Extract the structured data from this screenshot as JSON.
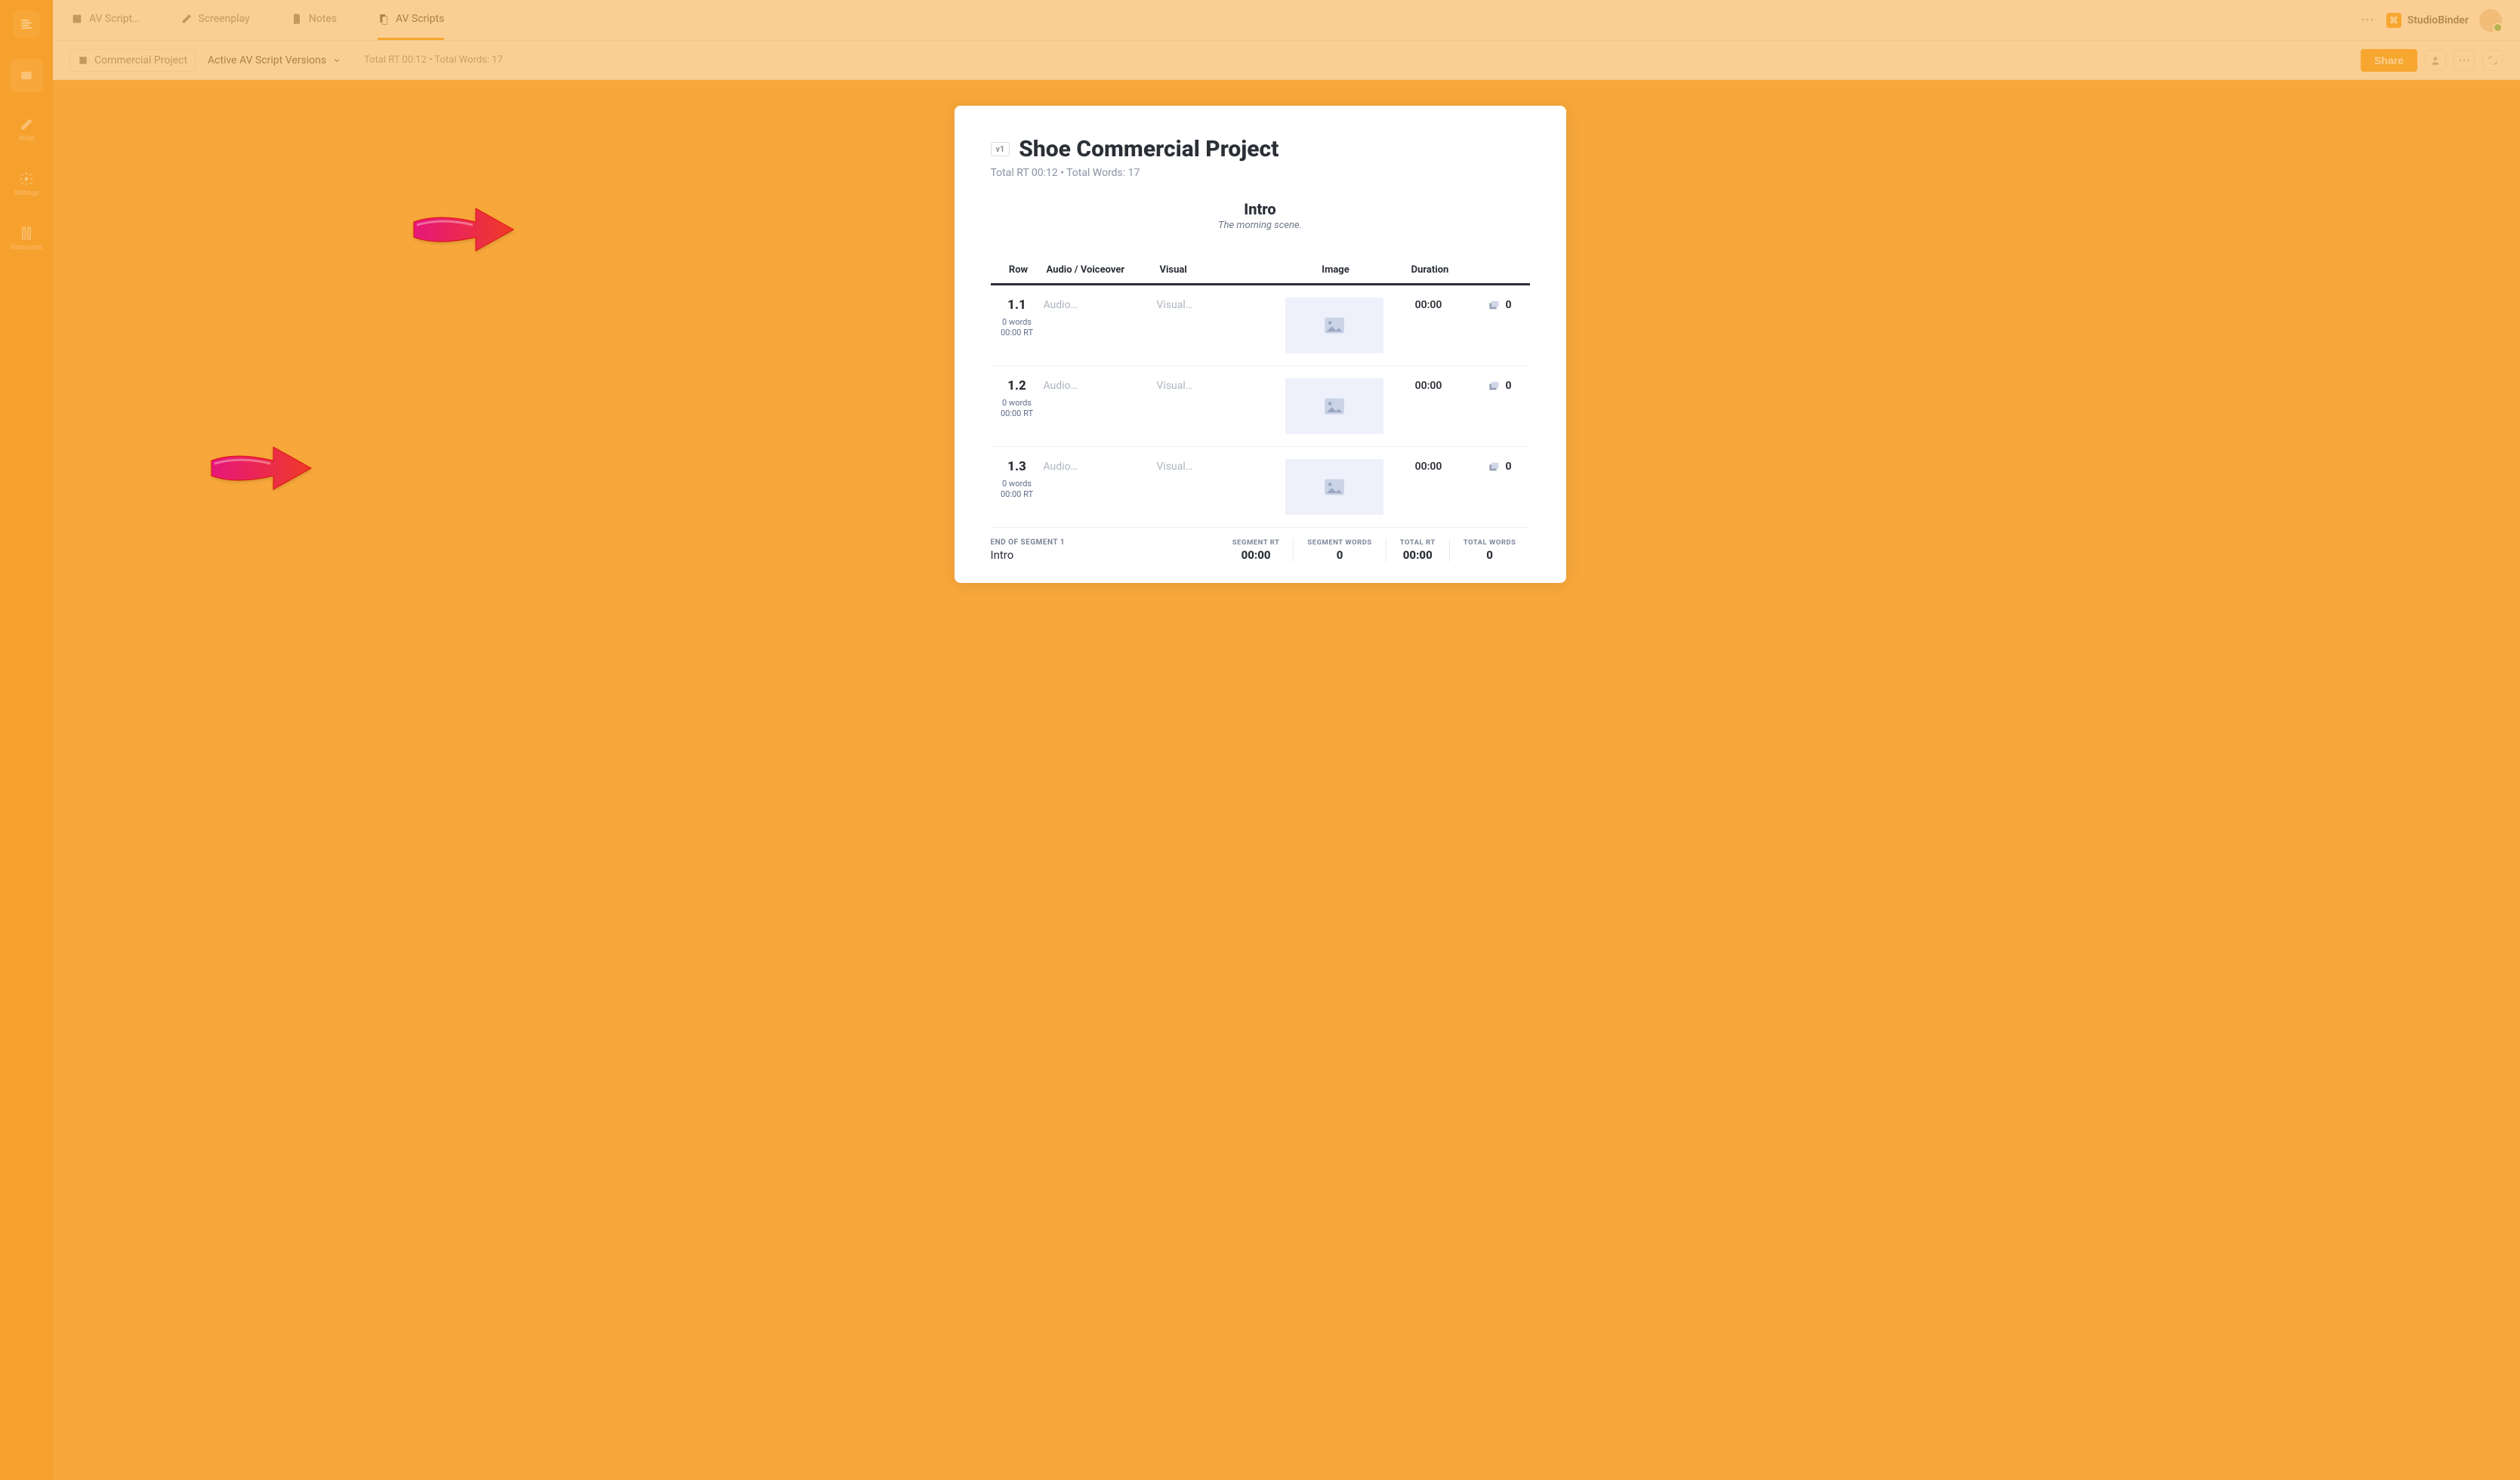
{
  "brand": {
    "name": "StudioBinder"
  },
  "rail": {
    "write": "Write",
    "settings": "Settings",
    "resources": "Resources"
  },
  "topbar": {
    "tabs": [
      {
        "label": "AV Script…"
      },
      {
        "label": "Screenplay"
      },
      {
        "label": "Notes"
      },
      {
        "label": "AV Scripts"
      }
    ]
  },
  "subbar": {
    "breadcrumb": "Commercial Project",
    "dropdown": "Active AV Script Versions",
    "meta": "Total RT 00:12 • Total Words: 17",
    "share": "Share"
  },
  "doc": {
    "version": "v1",
    "title": "Shoe Commercial Project",
    "subtitle": "Total RT 00:12 • Total Words: 17",
    "section": {
      "title": "Intro",
      "desc": "The morning scene."
    },
    "headers": {
      "row": "Row",
      "audio": "Audio / Voiceover",
      "visual": "Visual",
      "image": "Image",
      "duration": "Duration"
    },
    "placeholders": {
      "audio": "Audio…",
      "visual": "Visual…"
    },
    "rows": [
      {
        "num": "1.1",
        "words": "0 words",
        "rt": "00:00 RT",
        "duration": "00:00",
        "count": "0"
      },
      {
        "num": "1.2",
        "words": "0 words",
        "rt": "00:00 RT",
        "duration": "00:00",
        "count": "0"
      },
      {
        "num": "1.3",
        "words": "0 words",
        "rt": "00:00 RT",
        "duration": "00:00",
        "count": "0"
      }
    ],
    "footer": {
      "end_label": "END OF SEGMENT 1",
      "end_value": "Intro",
      "stats": [
        {
          "label": "SEGMENT RT",
          "value": "00:00"
        },
        {
          "label": "SEGMENT WORDS",
          "value": "0"
        },
        {
          "label": "TOTAL RT",
          "value": "00:00"
        },
        {
          "label": "TOTAL WORDS",
          "value": "0"
        }
      ]
    }
  }
}
